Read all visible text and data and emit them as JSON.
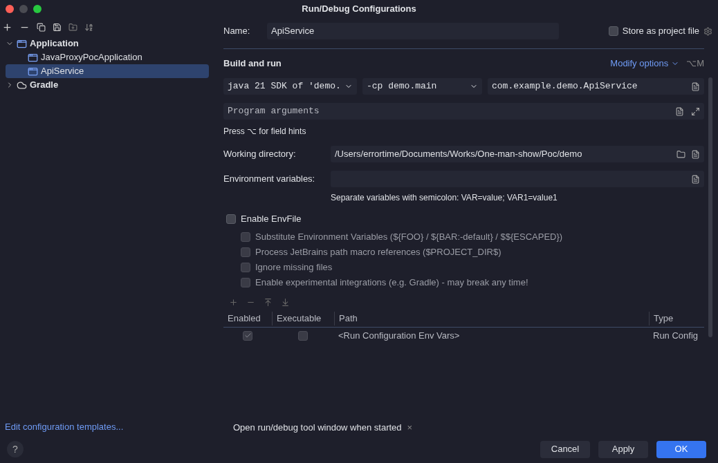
{
  "window": {
    "title": "Run/Debug Configurations"
  },
  "tree": [
    {
      "label": "Application",
      "expanded": true,
      "selected": false,
      "kind": "app",
      "children": [
        {
          "label": "JavaProxyPocApplication",
          "selected": false,
          "kind": "app"
        },
        {
          "label": "ApiService",
          "selected": true,
          "kind": "app"
        }
      ]
    },
    {
      "label": "Gradle",
      "expanded": false,
      "selected": false,
      "kind": "gradle"
    }
  ],
  "templates_link": "Edit configuration templates...",
  "name": {
    "label": "Name:",
    "value": "ApiService"
  },
  "store_as_project_file": {
    "label": "Store as project file",
    "checked": false
  },
  "build_and_run": {
    "title": "Build and run",
    "modify_options": "Modify options",
    "shortcut": "⌥M",
    "jdk": "java 21 SDK of 'demo.",
    "classpath": "-cp demo.main",
    "main_class": "com.example.demo.ApiService",
    "program_arguments": {
      "placeholder": "Program arguments"
    },
    "hint": "Press ⌥ for field hints"
  },
  "working_directory": {
    "label": "Working directory:",
    "value": "/Users/errortime/Documents/Works/One-man-show/Poc/demo"
  },
  "environment_variables": {
    "label": "Environment variables:",
    "hint": "Separate variables with semicolon: VAR=value; VAR1=value1"
  },
  "envfile": {
    "label": "Enable EnvFile",
    "checked": false,
    "options": [
      {
        "label": "Substitute Environment Variables (${FOO} / ${BAR:-default} / $${ESCAPED})",
        "checked": false
      },
      {
        "label": "Process JetBrains path macro references ($PROJECT_DIR$)",
        "checked": false
      },
      {
        "label": "Ignore missing files",
        "checked": false
      },
      {
        "label": "Enable experimental integrations (e.g. Gradle) - may break any time!",
        "checked": false
      }
    ]
  },
  "env_table": {
    "columns": [
      "Enabled",
      "Executable",
      "Path",
      "Type"
    ],
    "rows": [
      {
        "enabled": true,
        "executable": false,
        "path": "<Run Configuration Env Vars>",
        "type": "Run Config"
      }
    ]
  },
  "before_launch": {
    "label": "Open run/debug tool window when started",
    "close": "×"
  },
  "buttons": [
    {
      "label": "Cancel",
      "kind": "normal"
    },
    {
      "label": "Apply",
      "kind": "normal"
    },
    {
      "label": "OK",
      "kind": "default"
    }
  ],
  "help": "?"
}
